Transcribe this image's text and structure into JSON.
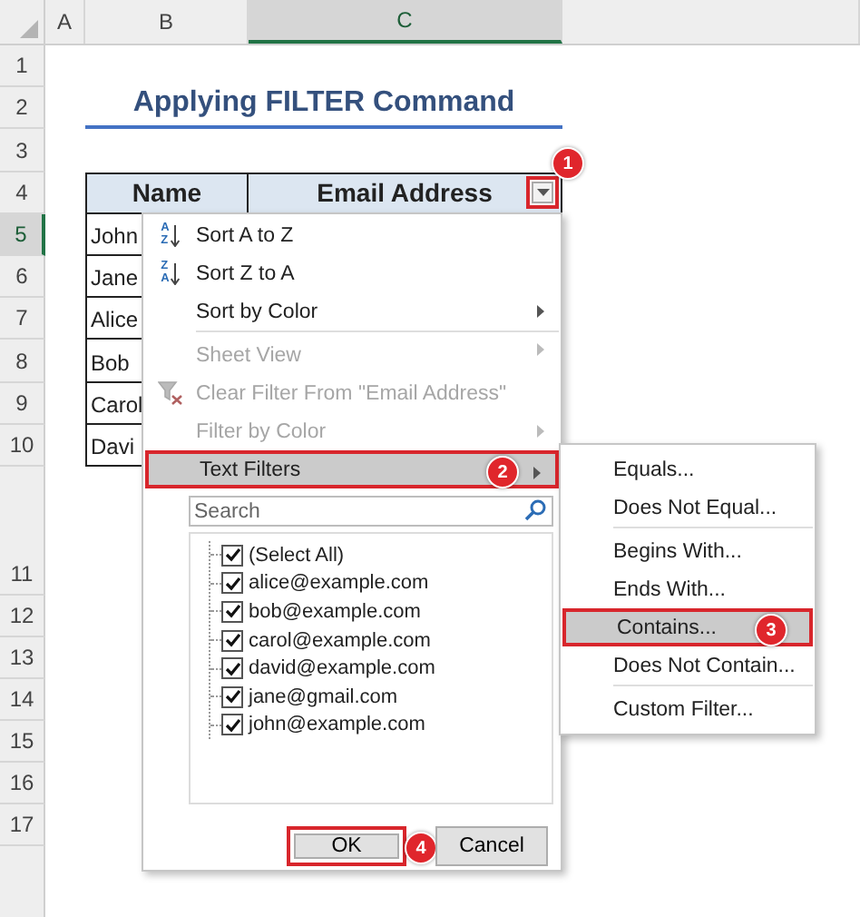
{
  "columns": [
    {
      "label": "A",
      "selected": false
    },
    {
      "label": "B",
      "selected": false
    },
    {
      "label": "C",
      "selected": true
    }
  ],
  "rows": [
    {
      "label": "1",
      "selected": false
    },
    {
      "label": "2",
      "selected": false
    },
    {
      "label": "3",
      "selected": false
    },
    {
      "label": "4",
      "selected": false
    },
    {
      "label": "5",
      "selected": true
    },
    {
      "label": "6",
      "selected": false
    },
    {
      "label": "7",
      "selected": false
    },
    {
      "label": "8",
      "selected": false
    },
    {
      "label": "9",
      "selected": false
    },
    {
      "label": "10",
      "selected": false
    },
    {
      "label": "11",
      "selected": false
    },
    {
      "label": "12",
      "selected": false
    },
    {
      "label": "13",
      "selected": false
    },
    {
      "label": "14",
      "selected": false
    },
    {
      "label": "15",
      "selected": false
    },
    {
      "label": "16",
      "selected": false
    },
    {
      "label": "17",
      "selected": false
    }
  ],
  "title": "Applying FILTER Command",
  "table": {
    "headers": [
      "Name",
      "Email Address"
    ],
    "names": [
      "John",
      "Jane",
      "Alice",
      "Bob",
      "Carol",
      "Davi"
    ]
  },
  "filter_button": {
    "outlined": true,
    "badge": "1"
  },
  "menu": {
    "items": [
      {
        "label": "Sort A to Z",
        "kind": "sort",
        "icon_letters": [
          "A",
          "Z"
        ],
        "disabled": false,
        "submenu": false,
        "separator_before": false,
        "selected": false,
        "outlined": false
      },
      {
        "label": "Sort Z to A",
        "kind": "sort",
        "icon_letters": [
          "Z",
          "A"
        ],
        "disabled": false,
        "submenu": false,
        "separator_before": false,
        "selected": false,
        "outlined": false
      },
      {
        "label": "Sort by Color",
        "kind": "plain",
        "disabled": false,
        "submenu": true,
        "separator_before": false,
        "selected": false,
        "outlined": false
      },
      {
        "label": "Sheet View",
        "kind": "plain",
        "disabled": true,
        "submenu": true,
        "separator_before": true,
        "selected": false,
        "outlined": false
      },
      {
        "label": "Clear Filter From \"Email Address\"",
        "kind": "clear_filter",
        "disabled": true,
        "submenu": false,
        "separator_before": false,
        "selected": false,
        "outlined": false
      },
      {
        "label": "Filter by Color",
        "kind": "plain",
        "disabled": true,
        "submenu": true,
        "separator_before": false,
        "selected": false,
        "outlined": false
      },
      {
        "label": "Text Filters",
        "kind": "plain",
        "disabled": false,
        "submenu": true,
        "separator_before": false,
        "selected": true,
        "outlined": true,
        "badge": "2"
      }
    ],
    "search": {
      "placeholder": "Search"
    },
    "values": [
      {
        "label": "(Select All)",
        "checked": true
      },
      {
        "label": "alice@example.com",
        "checked": true
      },
      {
        "label": "bob@example.com",
        "checked": true
      },
      {
        "label": "carol@example.com",
        "checked": true
      },
      {
        "label": "david@example.com",
        "checked": true
      },
      {
        "label": "jane@gmail.com",
        "checked": true
      },
      {
        "label": "john@example.com",
        "checked": true
      }
    ],
    "buttons": [
      {
        "label": "OK",
        "outlined": true,
        "badge": "4"
      },
      {
        "label": "Cancel",
        "outlined": false
      }
    ]
  },
  "submenu": {
    "items": [
      {
        "label": "Equals...",
        "separator_before": false,
        "selected": false,
        "outlined": false
      },
      {
        "label": "Does Not Equal...",
        "separator_before": false,
        "selected": false,
        "outlined": false
      },
      {
        "label": "Begins With...",
        "separator_before": true,
        "selected": false,
        "outlined": false
      },
      {
        "label": "Ends With...",
        "separator_before": false,
        "selected": false,
        "outlined": false
      },
      {
        "label": "Contains...",
        "separator_before": false,
        "selected": true,
        "outlined": true,
        "badge": "3"
      },
      {
        "label": "Does Not Contain...",
        "separator_before": false,
        "selected": false,
        "outlined": false
      },
      {
        "label": "Custom Filter...",
        "separator_before": true,
        "selected": false,
        "outlined": false
      }
    ]
  }
}
